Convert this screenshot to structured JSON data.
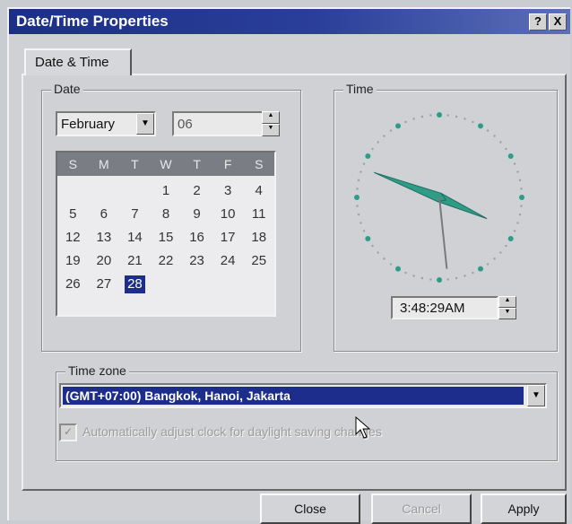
{
  "window": {
    "title": "Date/Time Properties",
    "help_label": "?",
    "close_label": "X"
  },
  "tabs": [
    {
      "label": "Date & Time"
    }
  ],
  "date": {
    "group_label": "Date",
    "month": "February",
    "year": "06",
    "weekdays": [
      "S",
      "M",
      "T",
      "W",
      "T",
      "F",
      "S"
    ],
    "days": [
      "",
      "",
      "",
      "1",
      "2",
      "3",
      "4",
      "5",
      "6",
      "7",
      "8",
      "9",
      "10",
      "11",
      "12",
      "13",
      "14",
      "15",
      "16",
      "17",
      "18",
      "19",
      "20",
      "21",
      "22",
      "23",
      "24",
      "25",
      "26",
      "27",
      "28",
      "",
      "",
      "",
      ""
    ],
    "selected_day": "28"
  },
  "time": {
    "group_label": "Time",
    "value": "3:48:29AM",
    "hour": 3,
    "minute": 48,
    "second": 29
  },
  "timezone": {
    "group_label": "Time zone",
    "selected": "(GMT+07:00) Bangkok, Hanoi, Jakarta",
    "dst_label": "Automatically adjust clock for daylight saving changes",
    "dst_checked": true,
    "dst_enabled": false
  },
  "buttons": {
    "close": "Close",
    "cancel": "Cancel",
    "apply": "Apply"
  },
  "colors": {
    "titlebar": "#1b2f86",
    "selection": "#1c2d8c",
    "clock_hand": "#2e9c86"
  }
}
